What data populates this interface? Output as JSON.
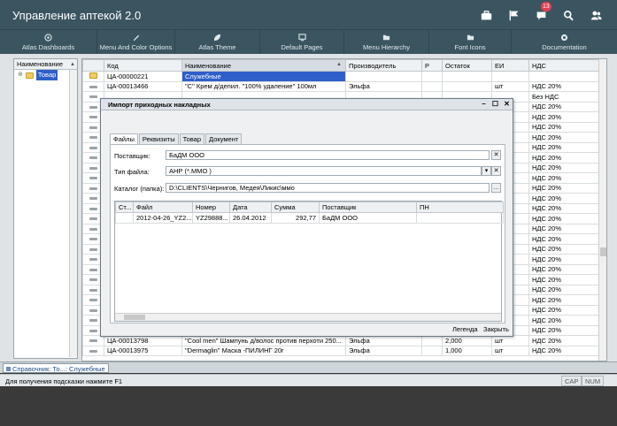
{
  "app": {
    "title": "Управление аптекой 2.0",
    "notification_count": "13"
  },
  "topbar_icons": [
    "briefcase-icon",
    "flag-icon",
    "chat-icon",
    "search-icon",
    "users-icon"
  ],
  "menu": [
    {
      "label": "Atlas Dashboards",
      "icon": "dashboard-icon"
    },
    {
      "label": "Menu And Color Options",
      "icon": "palette-icon"
    },
    {
      "label": "Atlas Theme",
      "icon": "leaf-icon"
    },
    {
      "label": "Default Pages",
      "icon": "monitor-icon"
    },
    {
      "label": "Menu Hierarchy",
      "icon": "folder-icon"
    },
    {
      "label": "Font Icons",
      "icon": "folder-icon"
    },
    {
      "label": "Documentation",
      "icon": "lifebuoy-icon"
    }
  ],
  "tree": {
    "header": "Наименование",
    "node": "Товар"
  },
  "grid": {
    "columns": [
      "Код",
      "Наименование",
      "Производитель",
      "Р",
      "Остаток",
      "ЕИ",
      "НДС"
    ],
    "rows": [
      {
        "code": "ЦА-00000221",
        "name": "Служебные",
        "maker": "",
        "r": "",
        "stock": "",
        "unit": "",
        "vat": "",
        "folder": true
      },
      {
        "code": "ЦА-00013466",
        "name": "\"С\" Крем д/депил. \"100% удаление\" 100мл",
        "maker": "Эльфа",
        "r": "",
        "stock": "",
        "unit": "шт",
        "vat": "НДС 20%"
      },
      {
        "code": "",
        "name": "",
        "maker": "",
        "r": "",
        "stock": "",
        "unit": "",
        "vat": "Без НДС"
      },
      {
        "code": "",
        "name": "",
        "maker": "",
        "r": "",
        "stock": "",
        "unit": "",
        "vat": "НДС 20%"
      },
      {
        "code": "",
        "name": "",
        "maker": "",
        "r": "",
        "stock": "",
        "unit": "",
        "vat": "НДС 20%"
      },
      {
        "code": "",
        "name": "",
        "maker": "",
        "r": "",
        "stock": "",
        "unit": "",
        "vat": "НДС 20%"
      },
      {
        "code": "",
        "name": "",
        "maker": "",
        "r": "",
        "stock": "",
        "unit": "",
        "vat": "НДС 20%"
      },
      {
        "code": "",
        "name": "",
        "maker": "",
        "r": "",
        "stock": "",
        "unit": "",
        "vat": "НДС 20%"
      },
      {
        "code": "",
        "name": "",
        "maker": "",
        "r": "",
        "stock": "",
        "unit": "",
        "vat": "НДС 20%"
      },
      {
        "code": "",
        "name": "",
        "maker": "",
        "r": "",
        "stock": "",
        "unit": "",
        "vat": "НДС 20%"
      },
      {
        "code": "",
        "name": "",
        "maker": "",
        "r": "",
        "stock": "",
        "unit": "",
        "vat": "НДС 20%"
      },
      {
        "code": "",
        "name": "",
        "maker": "",
        "r": "",
        "stock": "",
        "unit": "",
        "vat": "НДС 20%"
      },
      {
        "code": "",
        "name": "",
        "maker": "",
        "r": "",
        "stock": "",
        "unit": "",
        "vat": "НДС 20%"
      },
      {
        "code": "",
        "name": "",
        "maker": "",
        "r": "",
        "stock": "",
        "unit": "",
        "vat": "НДС 20%"
      },
      {
        "code": "",
        "name": "",
        "maker": "",
        "r": "",
        "stock": "",
        "unit": "",
        "vat": "НДС 20%"
      },
      {
        "code": "",
        "name": "",
        "maker": "",
        "r": "",
        "stock": "",
        "unit": "",
        "vat": "НДС 20%"
      },
      {
        "code": "",
        "name": "",
        "maker": "",
        "r": "",
        "stock": "",
        "unit": "",
        "vat": "НДС 20%"
      },
      {
        "code": "",
        "name": "",
        "maker": "",
        "r": "",
        "stock": "",
        "unit": "",
        "vat": "НДС 20%"
      },
      {
        "code": "",
        "name": "",
        "maker": "",
        "r": "",
        "stock": "",
        "unit": "",
        "vat": "НДС 20%"
      },
      {
        "code": "",
        "name": "",
        "maker": "",
        "r": "",
        "stock": "",
        "unit": "",
        "vat": "НДС 20%"
      },
      {
        "code": "",
        "name": "",
        "maker": "",
        "r": "",
        "stock": "",
        "unit": "",
        "vat": "НДС 20%"
      },
      {
        "code": "",
        "name": "",
        "maker": "",
        "r": "",
        "stock": "",
        "unit": "",
        "vat": "НДС 20%"
      },
      {
        "code": "",
        "name": "",
        "maker": "",
        "r": "",
        "stock": "",
        "unit": "",
        "vat": "НДС 20%"
      },
      {
        "code": "",
        "name": "",
        "maker": "",
        "r": "",
        "stock": "",
        "unit": "",
        "vat": "НДС 20%"
      },
      {
        "code": "",
        "name": "",
        "maker": "",
        "r": "",
        "stock": "",
        "unit": "",
        "vat": "НДС 20%"
      },
      {
        "code": "",
        "name": "",
        "maker": "",
        "r": "",
        "stock": "",
        "unit": "",
        "vat": "НДС 20%"
      },
      {
        "code": "ЦА-00013798",
        "name": "\"Cool men\" Шампунь д/волос против перхоти 250...",
        "maker": "Эльфа",
        "r": "",
        "stock": "2,000",
        "unit": "шт",
        "vat": "НДС 20%"
      },
      {
        "code": "ЦА-00013975",
        "name": "\"Dermaglin\" Маска -ПИЛИНГ 20г",
        "maker": "Эльфа",
        "r": "",
        "stock": "1,000",
        "unit": "шт",
        "vat": "НДС 20%"
      }
    ]
  },
  "dialog": {
    "title": "Импорт приходных накладных",
    "tabs": [
      "Файлы",
      "Реквизиты",
      "Товар",
      "Документ"
    ],
    "supplier_label": "Поставщик:",
    "supplier_value": "БаДМ ООО",
    "filetype_label": "Тип файла:",
    "filetype_value": "АНР  (*.ММО )",
    "catalog_label": "Каталог (папка):",
    "catalog_value": "D:\\CLIENTS\\Чернигов, Медея\\Ликис\\ммо",
    "file_columns": [
      "Ст...",
      "Файл",
      "Номер",
      "Дата",
      "Сумма",
      "Поставщик",
      "ПН"
    ],
    "file_rows": [
      {
        "st": "",
        "file": "2012-04-26_YZ2...",
        "number": "YZ29888...",
        "date": "26.04.2012",
        "sum": "292,77",
        "supplier": "БаДМ ООО",
        "pn": ""
      }
    ],
    "legend_label": "Легенда",
    "close_label": "Закрыть"
  },
  "taskbar": {
    "window_label": "Справочник: То...: Служебные"
  },
  "status": {
    "hint": "Для получения подсказки нажмите F1",
    "cap": "CAP",
    "num": "NUM"
  }
}
